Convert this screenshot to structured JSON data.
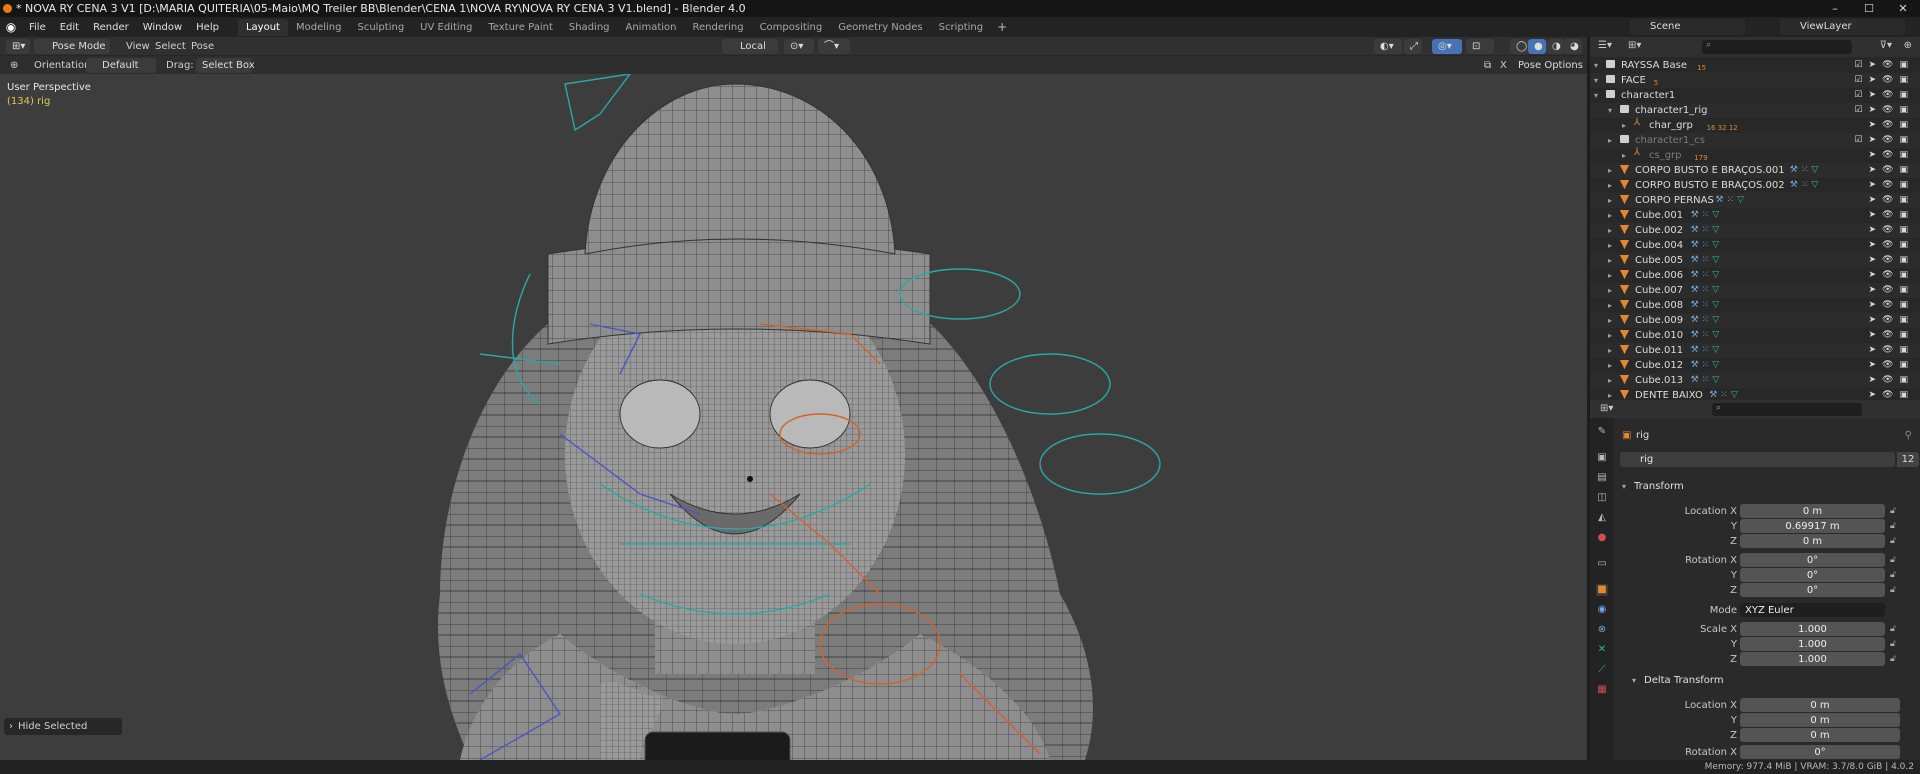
{
  "window": {
    "title": "* NOVA RY CENA 3 V1 [D:\\MARIA QUITERIA\\05-Maio\\MQ Treiler BB\\Blender\\CENA 1\\NOVA RY\\NOVA RY CENA 3 V1.blend] - Blender 4.0",
    "minimize": "–",
    "maximize": "☐",
    "close": "✕"
  },
  "menu": [
    "File",
    "Edit",
    "Render",
    "Window",
    "Help"
  ],
  "workspaces": [
    "Layout",
    "Modeling",
    "Sculpting",
    "UV Editing",
    "Texture Paint",
    "Shading",
    "Animation",
    "Rendering",
    "Compositing",
    "Geometry Nodes",
    "Scripting"
  ],
  "active_workspace": "Layout",
  "add_workspace": "+",
  "scene": "Scene",
  "view_layer": "ViewLayer",
  "viewport_header": {
    "mode": "Pose Mode",
    "menus": [
      "View",
      "Select",
      "Pose"
    ],
    "transform_orientation": "Local",
    "orientation_label": "Orientation:",
    "orientation_value": "Default",
    "drag_label": "Drag:",
    "drag_value": "Select Box",
    "pose_options": "Pose Options"
  },
  "viewport": {
    "perspective": "User Perspective",
    "active": "(134) rig",
    "operator_panel": "Hide Selected"
  },
  "outliner": {
    "rows": [
      {
        "label": "RAYSSA Base",
        "type": "coll",
        "depth": 0,
        "badge": "15",
        "dim": false
      },
      {
        "label": "FACE",
        "type": "coll",
        "depth": 0,
        "badge": "5",
        "dim": false
      },
      {
        "label": "character1",
        "type": "coll",
        "depth": 0,
        "badge": "",
        "dim": false
      },
      {
        "label": "character1_rig",
        "type": "coll",
        "depth": 1,
        "badge": "",
        "dim": false
      },
      {
        "label": "char_grp",
        "type": "arm",
        "depth": 2,
        "badge": "16 32 12",
        "dim": false
      },
      {
        "label": "character1_cs",
        "type": "coll",
        "depth": 1,
        "badge": "",
        "dim": true
      },
      {
        "label": "cs_grp",
        "type": "arm",
        "depth": 2,
        "badge": "179",
        "dim": true
      },
      {
        "label": "CORPO BUSTO E BRAÇOS.001",
        "type": "mesh",
        "depth": 1,
        "badge": "",
        "dim": false
      },
      {
        "label": "CORPO BUSTO E BRAÇOS.002",
        "type": "mesh",
        "depth": 1,
        "badge": "",
        "dim": false
      },
      {
        "label": "CORPO PERNAS",
        "type": "mesh",
        "depth": 1,
        "badge": "",
        "dim": false
      },
      {
        "label": "Cube.001",
        "type": "mesh",
        "depth": 1,
        "badge": "",
        "dim": false
      },
      {
        "label": "Cube.002",
        "type": "mesh",
        "depth": 1,
        "badge": "",
        "dim": false
      },
      {
        "label": "Cube.004",
        "type": "mesh",
        "depth": 1,
        "badge": "",
        "dim": false
      },
      {
        "label": "Cube.005",
        "type": "mesh",
        "depth": 1,
        "badge": "",
        "dim": false
      },
      {
        "label": "Cube.006",
        "type": "mesh",
        "depth": 1,
        "badge": "",
        "dim": false
      },
      {
        "label": "Cube.007",
        "type": "mesh",
        "depth": 1,
        "badge": "",
        "dim": false
      },
      {
        "label": "Cube.008",
        "type": "mesh",
        "depth": 1,
        "badge": "",
        "dim": false
      },
      {
        "label": "Cube.009",
        "type": "mesh",
        "depth": 1,
        "badge": "",
        "dim": false
      },
      {
        "label": "Cube.010",
        "type": "mesh",
        "depth": 1,
        "badge": "",
        "dim": false
      },
      {
        "label": "Cube.011",
        "type": "mesh",
        "depth": 1,
        "badge": "",
        "dim": false
      },
      {
        "label": "Cube.012",
        "type": "mesh",
        "depth": 1,
        "badge": "",
        "dim": false
      },
      {
        "label": "Cube.013",
        "type": "mesh",
        "depth": 1,
        "badge": "",
        "dim": false
      },
      {
        "label": "DENTE BAIXO",
        "type": "mesh",
        "depth": 1,
        "badge": "",
        "dim": false
      }
    ]
  },
  "properties": {
    "object_name": "rig",
    "datablock": "rig",
    "users": "12",
    "transform_title": "Transform",
    "location": {
      "label_x": "Location X",
      "x": "0 m",
      "y": "0.69917 m",
      "z": "0 m"
    },
    "rotation": {
      "label_x": "Rotation X",
      "x": "0°",
      "y": "0°",
      "z": "0°"
    },
    "mode_label": "Mode",
    "mode": "XYZ Euler",
    "scale": {
      "label_x": "Scale X",
      "x": "1.000",
      "y": "1.000",
      "z": "1.000"
    },
    "delta_title": "Delta Transform",
    "delta_location": {
      "label_x": "Location X",
      "x": "0 m",
      "y": "0 m",
      "z": "0 m"
    },
    "delta_rotation": {
      "label_x": "Rotation X",
      "x": "0°"
    },
    "axis_y": "Y",
    "axis_z": "Z"
  },
  "status": {
    "memory": "Memory: 977.4 MiB | VRAM: 3.7/8.0 GiB | 4.0.2"
  },
  "colors": {
    "wireframe_teal": "#2aa8a8",
    "bone_orange": "#d4622a",
    "bone_blue": "#4b55c8",
    "mesh_icon": "#e4872d",
    "accent": "#4772b3"
  }
}
